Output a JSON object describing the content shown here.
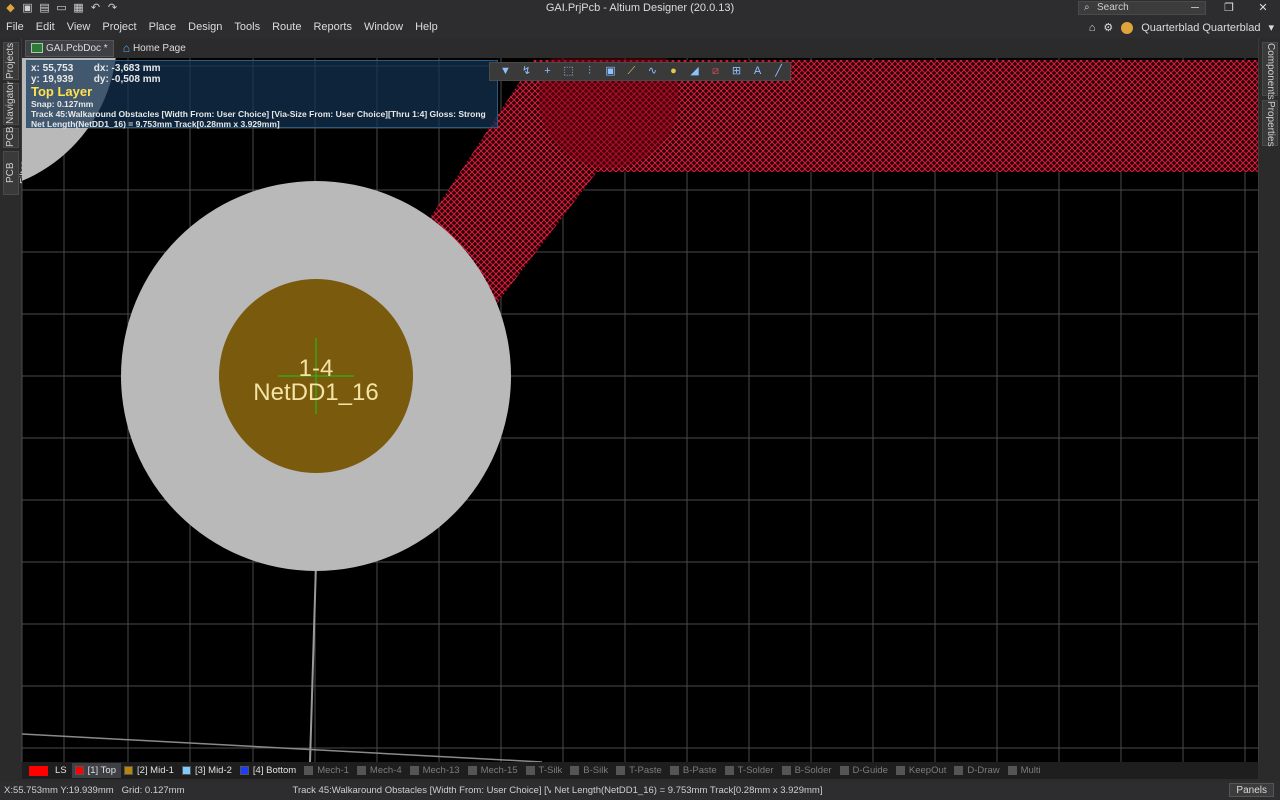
{
  "window": {
    "title": "GAI.PrjPcb - Altium Designer (20.0.13)",
    "search_placeholder": "Search",
    "user": "Quarterblad Quarterblad"
  },
  "menu": [
    "File",
    "Edit",
    "View",
    "Project",
    "Place",
    "Design",
    "Tools",
    "Route",
    "Reports",
    "Window",
    "Help"
  ],
  "left_panels": [
    "Projects",
    "Navigator",
    "PCB",
    "PCB Filter"
  ],
  "right_panels": [
    "Components",
    "Properties"
  ],
  "doc_tabs": [
    {
      "label": "GAI.PcbDoc *",
      "active": true
    },
    {
      "label": "Home Page",
      "active": false
    }
  ],
  "hud": {
    "x": "x: 55,753",
    "dx": "dx: -3,683 mm",
    "y": "y: 19,939",
    "dy": "dy: -0,508 mm",
    "layer": "Top Layer",
    "snap": "Snap: 0.127mm",
    "track": "Track 45:Walkaround Obstacles [Width From: User Choice] [Via-Size From: User Choice][Thru 1:4] Gloss: Strong",
    "net": "Net Length(NetDD1_16) = 9.753mm Track[0.28mm x 3.929mm]"
  },
  "pad": {
    "designator": "1-4",
    "net": "NetDD1_16"
  },
  "layers": [
    {
      "label": "LS",
      "color": "#ff0000",
      "on": true
    },
    {
      "label": "[1] Top",
      "color": "#ff0000",
      "on": true,
      "selected": true
    },
    {
      "label": "[2] Mid-1",
      "color": "#b8860b",
      "on": true
    },
    {
      "label": "[3] Mid-2",
      "color": "#7ecbff",
      "on": true
    },
    {
      "label": "[4] Bottom",
      "color": "#1e3cff",
      "on": true
    },
    {
      "label": "Mech-1",
      "color": "#555555",
      "on": false
    },
    {
      "label": "Mech-4",
      "color": "#555555",
      "on": false
    },
    {
      "label": "Mech-13",
      "color": "#555555",
      "on": false
    },
    {
      "label": "Mech-15",
      "color": "#555555",
      "on": false
    },
    {
      "label": "T-Silk",
      "color": "#555555",
      "on": false
    },
    {
      "label": "B-Silk",
      "color": "#555555",
      "on": false
    },
    {
      "label": "T-Paste",
      "color": "#555555",
      "on": false
    },
    {
      "label": "B-Paste",
      "color": "#555555",
      "on": false
    },
    {
      "label": "T-Solder",
      "color": "#555555",
      "on": false
    },
    {
      "label": "B-Solder",
      "color": "#555555",
      "on": false
    },
    {
      "label": "D-Guide",
      "color": "#555555",
      "on": false
    },
    {
      "label": "KeepOut",
      "color": "#555555",
      "on": false
    },
    {
      "label": "D-Draw",
      "color": "#555555",
      "on": false
    },
    {
      "label": "Multi",
      "color": "#555555",
      "on": false
    }
  ],
  "status": {
    "coords": "X:55.753mm Y:19.939mm",
    "grid": "Grid: 0.127mm",
    "track": "Track 45:Walkaround Obstacles [Width From: User Choice] [Via-Size",
    "net": "Net Length(NetDD1_16) = 9.753mm Track[0.28mm x 3.929mm]",
    "panels": "Panels"
  },
  "colors": {
    "track": "#c0142c",
    "pad_outer": "#b9b9b9",
    "pad_inner": "#7a5a0c",
    "grid": "#5a5a5a",
    "pad_text": "#f3e3a4"
  }
}
